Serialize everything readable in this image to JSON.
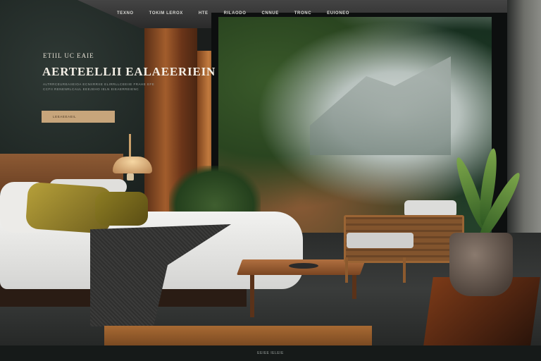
{
  "nav": {
    "items": [
      "TEXNO",
      "TOKIM LEROX",
      "HTE",
      "RILAODO",
      "CNNUE",
      "TRONC",
      "EUIONEO"
    ],
    "icon": "dog-logo-icon"
  },
  "hero": {
    "kicker": "ETIIL UC EAIE",
    "title": "AERTEELLII EALAEERIEIN",
    "body": "ALTRRCEUREAIIEIOA ECNIIRRIIE ELIRRLLCEEIIE FRAHE EFE CCFII RENENRLCAUL EEEJEHO IELN EIEAERREIENC",
    "cta_label": "LEEAEEAEIL"
  },
  "footer": {
    "text": "EEIEE IELEIE"
  },
  "colors": {
    "accent": "#c7a57b",
    "background_dark": "#1a1d1c"
  }
}
